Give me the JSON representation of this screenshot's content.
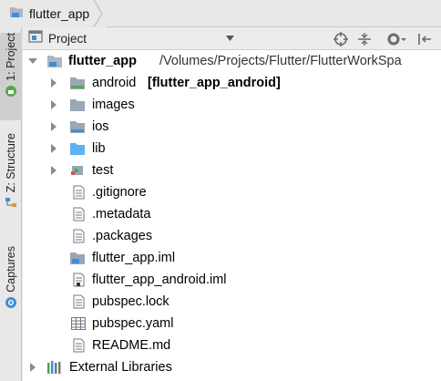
{
  "breadcrumb": {
    "project": "flutter_app"
  },
  "toolstrip": {
    "tabs": [
      {
        "label": "1: Project"
      },
      {
        "label": "Z: Structure"
      },
      {
        "label": "Captures"
      }
    ]
  },
  "panel": {
    "view_label": "Project"
  },
  "tree": {
    "root": {
      "name": "flutter_app",
      "path": "/Volumes/Projects/Flutter/FlutterWorkSpa"
    },
    "items": [
      {
        "name": "android",
        "suffix": "[flutter_app_android]",
        "icon": "folder-icon"
      },
      {
        "name": "images",
        "icon": "folder-icon"
      },
      {
        "name": "ios",
        "icon": "folder-icon"
      },
      {
        "name": "lib",
        "icon": "source-folder-icon"
      },
      {
        "name": "test",
        "icon": "test-folder-icon"
      },
      {
        "name": ".gitignore",
        "icon": "text-file-icon"
      },
      {
        "name": ".metadata",
        "icon": "text-file-icon"
      },
      {
        "name": ".packages",
        "icon": "text-file-icon"
      },
      {
        "name": "flutter_app.iml",
        "icon": "module-file-icon"
      },
      {
        "name": "flutter_app_android.iml",
        "icon": "module-file-icon"
      },
      {
        "name": "pubspec.lock",
        "icon": "text-file-icon"
      },
      {
        "name": "pubspec.yaml",
        "icon": "yaml-file-icon"
      },
      {
        "name": "README.md",
        "icon": "text-file-icon"
      }
    ],
    "external": {
      "name": "External Libraries",
      "icon": "libraries-icon"
    }
  },
  "colors": {
    "folder": "#9aa7b5",
    "source_folder": "#5fb3f0",
    "accent_blue": "#3d8fd6",
    "test_green": "#4aa84a"
  }
}
